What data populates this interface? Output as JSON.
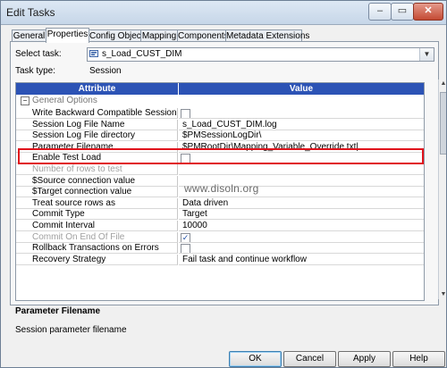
{
  "window": {
    "title": "Edit Tasks",
    "min_label": "–",
    "max_label": "▭",
    "close_label": "✕"
  },
  "tabs": [
    {
      "label": "General"
    },
    {
      "label": "Properties",
      "active": true
    },
    {
      "label": "Config Object"
    },
    {
      "label": "Mapping"
    },
    {
      "label": "Components"
    },
    {
      "label": "Metadata Extensions"
    }
  ],
  "form": {
    "select_task_label": "Select task:",
    "select_task_value": "s_Load_CUST_DIM",
    "task_type_label": "Task type:",
    "task_type_value": "Session"
  },
  "grid": {
    "col_attribute": "Attribute",
    "col_value": "Value",
    "group_label": "General Options",
    "group_toggle": "−",
    "rows": [
      {
        "attr": "Write Backward Compatible Session Log File",
        "value": "",
        "checkbox": true,
        "checked": false,
        "disabled": false
      },
      {
        "attr": "Session Log File Name",
        "value": "s_Load_CUST_DIM.log",
        "checkbox": false,
        "checked": false,
        "disabled": false
      },
      {
        "attr": "Session Log File directory",
        "value": "$PMSessionLogDir\\",
        "checkbox": false,
        "checked": false,
        "disabled": false
      },
      {
        "attr": "Parameter Filename",
        "value": "$PMRootDir\\Mapping_Variable_Override.txt|",
        "checkbox": false,
        "checked": false,
        "disabled": false
      },
      {
        "attr": "Enable Test Load",
        "value": "",
        "checkbox": true,
        "checked": false,
        "disabled": false
      },
      {
        "attr": "Number of rows to test",
        "value": "",
        "checkbox": false,
        "checked": false,
        "disabled": true
      },
      {
        "attr": "$Source connection value",
        "value": "",
        "checkbox": false,
        "checked": false,
        "disabled": false
      },
      {
        "attr": "$Target connection value",
        "value": "",
        "checkbox": false,
        "checked": false,
        "disabled": false
      },
      {
        "attr": "Treat source rows as",
        "value": "Data driven",
        "checkbox": false,
        "checked": false,
        "disabled": false
      },
      {
        "attr": "Commit Type",
        "value": "Target",
        "checkbox": false,
        "checked": false,
        "disabled": false
      },
      {
        "attr": "Commit Interval",
        "value": "10000",
        "checkbox": false,
        "checked": false,
        "disabled": false
      },
      {
        "attr": "Commit On End Of File",
        "value": "",
        "checkbox": true,
        "checked": true,
        "disabled": true
      },
      {
        "attr": "Rollback Transactions on Errors",
        "value": "",
        "checkbox": true,
        "checked": false,
        "disabled": false
      },
      {
        "attr": "Recovery Strategy",
        "value": "Fail task and continue workflow",
        "checkbox": false,
        "checked": false,
        "disabled": false
      }
    ]
  },
  "watermark": "www.disoln.org",
  "description": {
    "title": "Parameter Filename",
    "text": "Session parameter filename"
  },
  "buttons": {
    "ok": "OK",
    "cancel": "Cancel",
    "apply": "Apply",
    "help": "Help"
  },
  "icons": {
    "combo_icon": "session-task-icon",
    "checkmark": "✓"
  }
}
